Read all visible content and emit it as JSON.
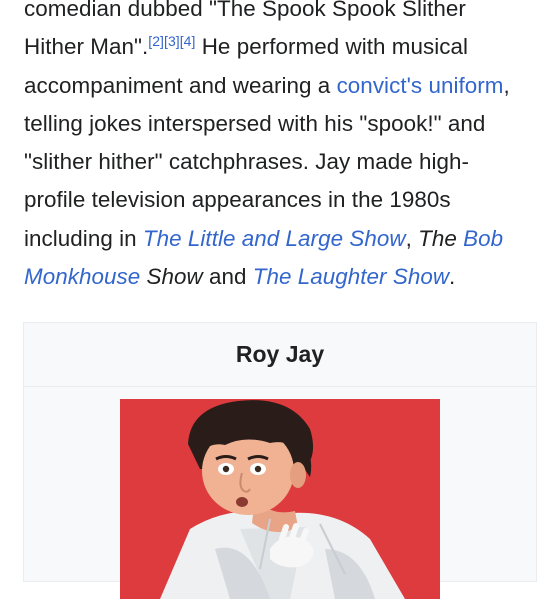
{
  "article": {
    "line1": {
      "text": "comedian dubbed \"The Spook Spook Slither"
    },
    "line2": {
      "text_before": "Hither Man\".",
      "refs": [
        "[2]",
        "[3]",
        "[4]"
      ],
      "text_after": " He performed with musical"
    },
    "line3": {
      "text_before": "accompaniment and wearing a ",
      "link": "convict's uniform",
      "text_after": ","
    },
    "line4": {
      "text": "telling jokes interspersed with his \"spook!\" and"
    },
    "line5": {
      "text": "\"slither hither\" catchphrases. Jay made high-"
    },
    "line6": {
      "text": "profile television appearances in the 1980s"
    },
    "line7": {
      "text_before": "including in ",
      "link1": "The Little and Large Show",
      "text_mid": ", ",
      "italic_text": "The ",
      "link2": "Bob"
    },
    "line8": {
      "link2_cont": "Monkhouse",
      "italic_text": " Show",
      "text_mid": " and ",
      "link3": "The Laughter Show",
      "text_after": "."
    }
  },
  "infobox": {
    "title": "Roy Jay",
    "image_subject": "portrait photo of Roy Jay"
  },
  "colors": {
    "link": "#3366cc",
    "text": "#202122",
    "infobox_bg": "#f8f9fa",
    "infobox_border": "#eaecf0",
    "photo_bg": "#dd3b3d"
  }
}
